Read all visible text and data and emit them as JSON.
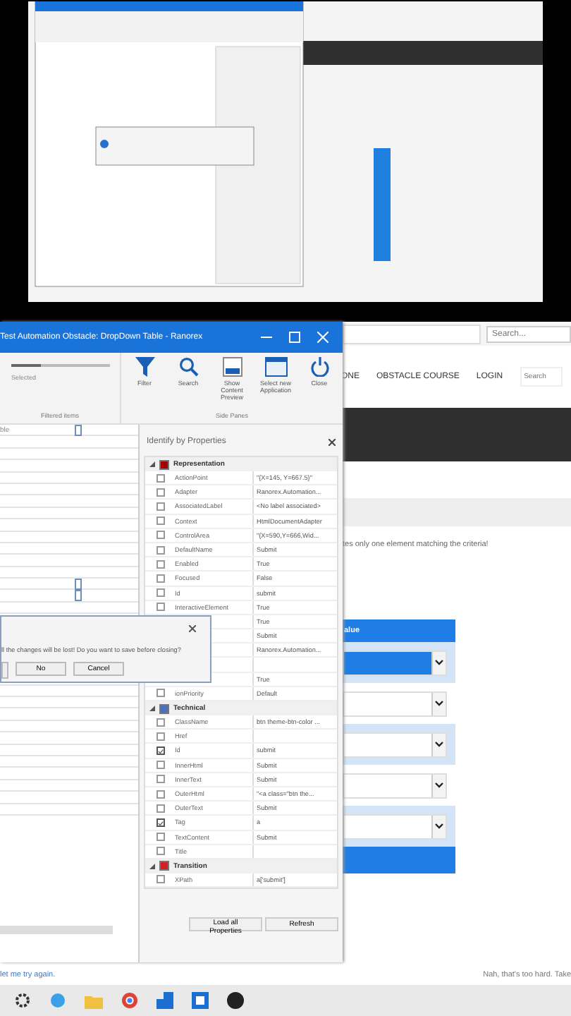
{
  "app_window": {
    "title": "Test Automation Obstacle: DropDown Table - Ranorex",
    "slider": {
      "label": "Selected",
      "level": 0.3
    },
    "group_labels": [
      "Filtered items",
      "Side Panes"
    ],
    "ribbon_buttons": [
      {
        "label": "Filter",
        "kind": "filter"
      },
      {
        "label": "Search",
        "kind": "search"
      },
      {
        "label": "Show Content Preview",
        "kind": "preview"
      },
      {
        "label": "Select new Application",
        "kind": "application"
      },
      {
        "label": "Close",
        "kind": "close"
      }
    ],
    "tree": {
      "first_row": "ble"
    },
    "properties": {
      "title": "Identify by Properties",
      "categories": [
        {
          "name": "Representation",
          "color": "#a50000",
          "expanded": true,
          "rows": [
            {
              "name": "ActionPoint",
              "value": "\"{X=145, Y=667.5}\"",
              "checked": false
            },
            {
              "name": "Adapter",
              "value": "Ranorex.Automation...",
              "checked": false
            },
            {
              "name": "AssociatedLabel",
              "value": "<No label associated>",
              "checked": false
            },
            {
              "name": "Context",
              "value": "HtmlDocumentAdapter",
              "checked": false
            },
            {
              "name": "ControlArea",
              "value": "\"{X=590,Y=666,Wid...",
              "checked": false
            },
            {
              "name": "DefaultName",
              "value": "Submit",
              "checked": false
            },
            {
              "name": "Enabled",
              "value": "True",
              "checked": false
            },
            {
              "name": "Focused",
              "value": "False",
              "checked": false
            },
            {
              "name": "Id",
              "value": "submit",
              "checked": false
            },
            {
              "name": "InteractiveElement",
              "value": "True",
              "checked": false
            },
            {
              "value": "True"
            },
            {
              "value": "Submit"
            },
            {
              "value": "Ranorex.Automation..."
            },
            {},
            {
              "value": "True"
            },
            {
              "name": "ionPriority",
              "value": "Default",
              "checked": false
            }
          ]
        },
        {
          "name": "Technical",
          "color": "#4a72c0",
          "expanded": true,
          "rows": [
            {
              "name": "ClassName",
              "value": "btn theme-btn-color ...",
              "checked": false
            },
            {
              "name": "Href",
              "checked": false
            },
            {
              "name": "Id",
              "value": "submit",
              "checked": true
            },
            {
              "name": "InnerHtml",
              "value": "Submit",
              "checked": false
            },
            {
              "name": "InnerText",
              "value": "Submit",
              "checked": false
            },
            {
              "name": "OuterHtml",
              "value": "\"<a class=\"btn the...",
              "checked": false
            },
            {
              "name": "OuterText",
              "value": "Submit",
              "checked": false
            },
            {
              "name": "Tag",
              "value": "a",
              "checked": true
            },
            {
              "name": "TextContent",
              "value": "Submit",
              "checked": false
            },
            {
              "name": "Title",
              "checked": false
            }
          ]
        },
        {
          "name": "Transition",
          "color": "#d42020",
          "expanded": true,
          "rows": [
            {
              "name": "XPath",
              "value": "a['submit']",
              "checked": false
            }
          ]
        }
      ],
      "buttons": [
        "Load all Properties",
        "Refresh"
      ]
    },
    "dialog": {
      "message": "ll the changes will be lost! Do you want to save before closing?",
      "buttons": [
        "No",
        "Cancel"
      ]
    }
  },
  "browser": {
    "search_placeholder": "Search...",
    "nav": [
      "ONE",
      "OBSTACLE COURSE",
      "LOGIN"
    ],
    "nav_search_placeholder": "Search",
    "message": "tes only one element matching the criteria!",
    "table_header": "alue",
    "dropdowns": [
      {
        "selected": true
      },
      {
        "selected": false
      },
      {
        "selected": false
      },
      {
        "selected": false
      },
      {
        "selected": false
      }
    ],
    "retry_link": "let me try again.",
    "hard_text": "Nah, that's too hard. Take"
  }
}
